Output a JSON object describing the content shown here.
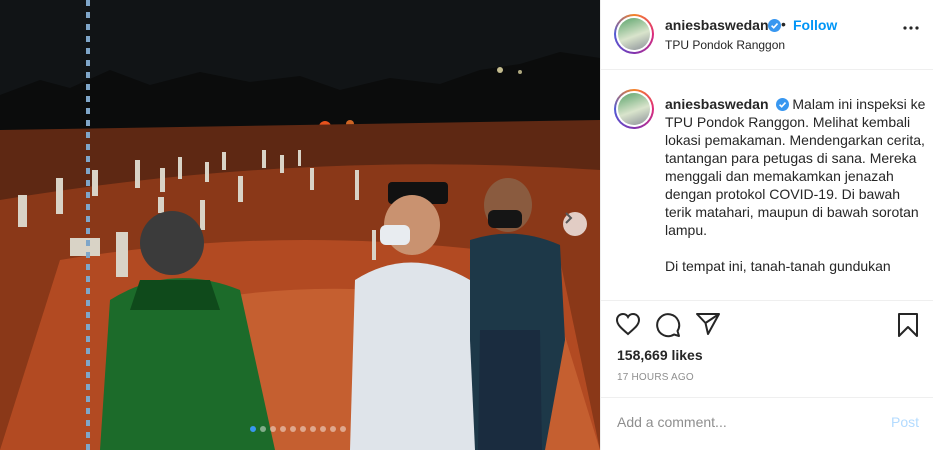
{
  "post": {
    "username": "aniesbaswedan",
    "verified": true,
    "follow_separator": "•",
    "follow_label": "Follow",
    "location": "TPU Pondok Ranggon",
    "caption_p1": "Malam ini inspeksi ke TPU Pondok Ranggon. Melihat kembali lokasi pemakaman. Mendengarkan cerita, tantangan para petugas di sana. Mereka menggali dan memakamkan jenazah dengan protokol COVID-19. Di bawah terik matahari, maupun di bawah sorotan lampu.",
    "caption_p2": "Di tempat ini, tanah-tanah gundukan",
    "likes": "158,669 likes",
    "timestamp": "17 HOURS AGO"
  },
  "comment": {
    "placeholder": "Add a comment...",
    "post_label": "Post"
  },
  "carousel": {
    "slide_count": 10,
    "active_index": 0
  },
  "icons": {
    "verified": "verified-badge-icon",
    "more": "more-options-icon",
    "like": "heart-icon",
    "comment": "comment-bubble-icon",
    "share": "paper-plane-icon",
    "save": "bookmark-icon",
    "next": "chevron-right-icon"
  },
  "colors": {
    "accent": "#0095f6",
    "verified": "#3897f0",
    "post_disabled": "#b3dbff",
    "muted": "#8e8e8e"
  }
}
